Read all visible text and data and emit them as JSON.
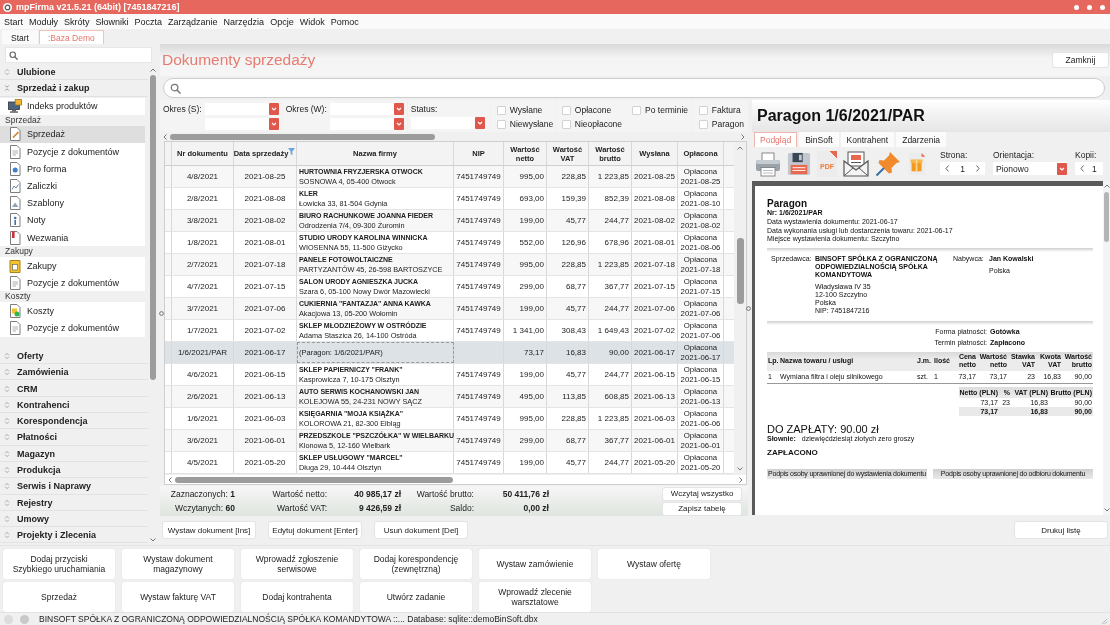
{
  "window": {
    "title": "mpFirma v21.5.21 (64bit) [7451847216]"
  },
  "menu": [
    "Start",
    "Moduły",
    "Skróty",
    "Słowniki",
    "Poczta",
    "Zarządzanie",
    "Narzędzia",
    "Opcje",
    "Widok",
    "Pomoc"
  ],
  "tabs": [
    {
      "label": "Start",
      "selected": false
    },
    {
      "label": ":Baza Demo",
      "selected": true
    }
  ],
  "sidebar": {
    "sections": [
      {
        "label": "Ulubione",
        "expanded": false
      },
      {
        "label": "Sprzedaż i zakup",
        "expanded": true,
        "items": [
          {
            "kind": "index",
            "label": "Indeks produktów",
            "selected": false
          },
          {
            "kind": "group",
            "label": "Sprzedaż"
          },
          {
            "kind": "sale",
            "label": "Sprzedaż",
            "selected": true
          },
          {
            "kind": "positions",
            "label": "Pozycje z dokumentów",
            "selected": false
          },
          {
            "kind": "proforma",
            "label": "Pro forma",
            "selected": false
          },
          {
            "kind": "advance",
            "label": "Zaliczki",
            "selected": false
          },
          {
            "kind": "template",
            "label": "Szablony",
            "selected": false
          },
          {
            "kind": "note",
            "label": "Noty",
            "selected": false
          },
          {
            "kind": "reminder",
            "label": "Wezwania",
            "selected": false
          },
          {
            "kind": "group",
            "label": "Zakupy"
          },
          {
            "kind": "purchase",
            "label": "Zakupy",
            "selected": false
          },
          {
            "kind": "positions",
            "label": "Pozycje z dokumentów",
            "selected": false
          },
          {
            "kind": "group",
            "label": "Koszty"
          },
          {
            "kind": "cost",
            "label": "Koszty",
            "selected": false
          },
          {
            "kind": "positions",
            "label": "Pozycje z dokumentów",
            "selected": false
          }
        ]
      },
      {
        "label": "Oferty",
        "expanded": false
      },
      {
        "label": "Zamówienia",
        "expanded": false
      },
      {
        "label": "CRM",
        "expanded": false
      },
      {
        "label": "Kontrahenci",
        "expanded": false
      },
      {
        "label": "Korespondencja",
        "expanded": false
      },
      {
        "label": "Płatności",
        "expanded": false
      },
      {
        "label": "Magazyn",
        "expanded": false
      },
      {
        "label": "Produkcja",
        "expanded": false
      },
      {
        "label": "Serwis i Naprawy",
        "expanded": false
      },
      {
        "label": "Rejestry",
        "expanded": false
      },
      {
        "label": "Umowy",
        "expanded": false
      },
      {
        "label": "Projekty i Zlecenia",
        "expanded": false
      }
    ]
  },
  "content": {
    "title": "Dokumenty sprzedaży",
    "close_button": "Zamknij"
  },
  "filters": {
    "periods": [
      {
        "label": "Okres (S):"
      },
      {
        "label": "Okres (W):"
      }
    ],
    "status": {
      "label": "Status:"
    },
    "checkbox_groups": [
      [
        [
          {
            "label": "Wysłane",
            "checked": false
          },
          {
            "label": "Niewysłane",
            "checked": false
          }
        ]
      ],
      [
        [
          {
            "label": "Opłacone",
            "checked": false
          },
          {
            "label": "Nieopłacone",
            "checked": false
          }
        ],
        [
          {
            "label": "Po terminie",
            "checked": false
          }
        ]
      ],
      [
        [
          {
            "label": "Faktura",
            "checked": false
          },
          {
            "label": "Paragon",
            "checked": false
          }
        ]
      ]
    ]
  },
  "table": {
    "columns": [
      {
        "label": "Nr dokumentu",
        "filtered": false
      },
      {
        "label": "Data sprzedaży",
        "filtered": true
      },
      {
        "label": "Nazwa firmy",
        "filtered": false
      },
      {
        "label": "NIP",
        "filtered": false
      },
      {
        "label": "Wartość netto",
        "filtered": false
      },
      {
        "label": "Wartość VAT",
        "filtered": false
      },
      {
        "label": "Wartość brutto",
        "filtered": false
      },
      {
        "label": "Wysłana",
        "filtered": false
      },
      {
        "label": "Opłacona",
        "filtered": false
      }
    ],
    "rows": [
      {
        "number": "4/8/2021",
        "date": "2021-08-25",
        "company": "HURTOWNIA FRYZJERSKA OTWOCK",
        "address": "SOSNOWA 4, 05-400 Otwock",
        "nip": "7451749749",
        "net": "995,00",
        "vat": "228,85",
        "gross": "1 223,85",
        "sent": "2021-08-25",
        "paid": "Opłacona",
        "paid_date": "2021-08-25",
        "selected": false
      },
      {
        "number": "2/8/2021",
        "date": "2021-08-08",
        "company": "KLER",
        "address": "Łowicka 33, 81-504 Gdynia",
        "nip": "7451749749",
        "net": "693,00",
        "vat": "159,39",
        "gross": "852,39",
        "sent": "2021-08-08",
        "paid": "Opłacona",
        "paid_date": "2021-08-10",
        "selected": false
      },
      {
        "number": "3/8/2021",
        "date": "2021-08-02",
        "company": "BIURO RACHUNKOWE JOANNA FIEDER",
        "address": "Odrodzenia 7/4, 09-300 Żuromin",
        "nip": "7451749749",
        "net": "199,00",
        "vat": "45,77",
        "gross": "244,77",
        "sent": "2021-08-02",
        "paid": "Opłacona",
        "paid_date": "2021-08-02",
        "selected": false
      },
      {
        "number": "1/8/2021",
        "date": "2021-08-01",
        "company": "STUDIO URODY KAROLINA WINNICKA",
        "address": "WIOSENNA 55, 11-500 Giżycko",
        "nip": "7451749749",
        "net": "552,00",
        "vat": "126,96",
        "gross": "678,96",
        "sent": "2021-08-01",
        "paid": "Opłacona",
        "paid_date": "2021-08-06",
        "selected": false
      },
      {
        "number": "2/7/2021",
        "date": "2021-07-18",
        "company": "PANELE FOTOWOLTAICZNE",
        "address": "PARTYZANTÓW 45, 26-598 BARTOSZYCE",
        "nip": "7451749749",
        "net": "995,00",
        "vat": "228,85",
        "gross": "1 223,85",
        "sent": "2021-07-18",
        "paid": "Opłacona",
        "paid_date": "2021-07-18",
        "selected": false
      },
      {
        "number": "4/7/2021",
        "date": "2021-07-15",
        "company": "SALON URODY AGNIESZKA JUCKA",
        "address": "Szara 6, 05-100 Nowy Dwór Mazowiecki",
        "nip": "7451749749",
        "net": "299,00",
        "vat": "68,77",
        "gross": "367,77",
        "sent": "2021-07-15",
        "paid": "Opłacona",
        "paid_date": "2021-07-15",
        "selected": false
      },
      {
        "number": "3/7/2021",
        "date": "2021-07-06",
        "company": "CUKIERNIA \"FANTAZJA\" ANNA KAWKA",
        "address": "Akacjowa 13, 05-200 Wołomin",
        "nip": "7451749749",
        "net": "199,00",
        "vat": "45,77",
        "gross": "244,77",
        "sent": "2021-07-06",
        "paid": "Opłacona",
        "paid_date": "2021-07-06",
        "selected": false
      },
      {
        "number": "1/7/2021",
        "date": "2021-07-02",
        "company": "SKLEP MŁODZIEŻOWY W OSTRÓDZIE",
        "address": "Adama Staszica 26, 14-100 Ostróda",
        "nip": "7451749749",
        "net": "1 341,00",
        "vat": "308,43",
        "gross": "1 649,43",
        "sent": "2021-07-02",
        "paid": "Opłacona",
        "paid_date": "2021-07-06",
        "selected": false
      },
      {
        "number": "1/6/2021/PAR",
        "date": "2021-06-17",
        "company": "(Paragon: 1/6/2021/PAR)",
        "net": "73,17",
        "vat": "16,83",
        "gross": "90,00",
        "sent": "2021-06-17",
        "paid": "Opłacona",
        "paid_date": "2021-06-17",
        "selected": true
      },
      {
        "number": "4/6/2021",
        "date": "2021-06-15",
        "company": "SKLEP PAPIERNICZY \"FRANK\"",
        "address": "Kasprowicza 7, 10-175 Olsztyn",
        "nip": "7451749749",
        "net": "199,00",
        "vat": "45,77",
        "gross": "244,77",
        "sent": "2021-06-15",
        "paid": "Opłacona",
        "paid_date": "2021-06-15",
        "selected": false
      },
      {
        "number": "2/6/2021",
        "date": "2021-06-13",
        "company": "AUTO SERWIS KOCHANOWSKI JAN",
        "address": "KOLEJOWA 55, 24-231 NOWY SĄCZ",
        "nip": "7451749749",
        "net": "495,00",
        "vat": "113,85",
        "gross": "608,85",
        "sent": "2021-06-13",
        "paid": "Opłacona",
        "paid_date": "2021-06-13",
        "selected": false
      },
      {
        "number": "1/6/2021",
        "date": "2021-06-03",
        "company": "KSIĘGARNIA \"MOJA KSIĄŻKA\"",
        "address": "KOLOROWA 21, 82-300 Elbląg",
        "nip": "7451749749",
        "net": "995,00",
        "vat": "228,85",
        "gross": "1 223,85",
        "sent": "2021-06-03",
        "paid": "Opłacona",
        "paid_date": "2021-06-06",
        "selected": false
      },
      {
        "number": "3/6/2021",
        "date": "2021-06-01",
        "company": "PRZEDSZKOLE \"PSZCZÓŁKA\" W WIELBARKU",
        "address": "Klonowa 5, 12-160 Wielbark",
        "nip": "7451749749",
        "net": "299,00",
        "vat": "68,77",
        "gross": "367,77",
        "sent": "2021-06-01",
        "paid": "Opłacona",
        "paid_date": "2021-06-01",
        "selected": false
      },
      {
        "number": "4/5/2021",
        "date": "2021-05-20",
        "company": "SKLEP USŁUGOWY \"MARCEL\"",
        "address": "Długa 29, 10-444 Olsztyn",
        "nip": "7451749749",
        "net": "199,00",
        "vat": "45,77",
        "gross": "244,77",
        "sent": "2021-05-20",
        "paid": "Opłacona",
        "paid_date": "2021-05-20",
        "selected": false
      }
    ]
  },
  "summary": {
    "rows": [
      {
        "count": "Zaznaczonych: **1**",
        "totals": [
          {
            "label": "Wartość netto:",
            "value": "40 985,17 zł"
          },
          {
            "label": "Wartość brutto:",
            "value": "50 411,76 zł"
          }
        ]
      },
      {
        "count": "Wczytanych: **60**",
        "totals": [
          {
            "label": "Wartość VAT:",
            "value": "9 426,59 zł"
          },
          {
            "label": "Saldo:",
            "value": "0,00 zł"
          }
        ]
      }
    ],
    "buttons": [
      "Wczytaj wszystko",
      "Zapisz tabelę"
    ]
  },
  "actions": [
    "Wystaw dokument [Ins]",
    "Edytuj dokument [Enter]",
    "Usuń dokument [Del]"
  ],
  "print_button": "Drukuj listę",
  "preview": {
    "title": "Paragon 1/6/2021/PAR",
    "tabs": [
      {
        "label": "Podgląd",
        "selected": true
      },
      {
        "label": "BinSoft",
        "selected": false
      },
      {
        "label": "Kontrahent",
        "selected": false
      },
      {
        "label": "Zdarzenia",
        "selected": false
      }
    ],
    "tools": [
      {
        "kind": "print"
      },
      {
        "kind": "save"
      },
      {
        "kind": "pdf",
        "label": "PDF"
      },
      {
        "kind": "email"
      },
      {
        "kind": "pin"
      },
      {
        "kind": "package"
      }
    ],
    "page": {
      "label": "Strona:",
      "value": "1"
    },
    "orientation": {
      "label": "Orientacja:",
      "value": "Pionowo"
    },
    "copies": {
      "label": "Kopii:",
      "value": "1"
    },
    "document": {
      "title": "Paragon",
      "number": "Nr: 1/6/2021/PAR",
      "details": [
        "Data wystawienia dokumentu: 2021-06-17",
        "Data wykonania usługi lub dostarczenia towaru: 2021-06-17",
        "Miejsce wystawienia dokumentu: Szczytno"
      ],
      "seller": {
        "label": "Sprzedawca:",
        "name": "BINSOFT SPÓŁKA Z OGRANICZONĄ ODPOWIEDZIALNOŚCIĄ SPÓŁKA KOMANDYTOWA",
        "address": [
          "Władysława IV 35",
          "12-100 Szczytno",
          "Polska",
          "NIP: 7451847216"
        ]
      },
      "buyer": {
        "label": "Nabywca:",
        "name": "Jan Kowalski",
        "address": [
          "Polska"
        ]
      },
      "payment": [
        {
          "label": "Forma płatności:",
          "value": "Gotówka"
        },
        {
          "label": "Termin płatności:",
          "value": "Zapłacono"
        }
      ],
      "items": {
        "columns": [
          "Lp.",
          "Nazwa towaru / usługi",
          "J.m.",
          "Ilość",
          "Cena netto",
          "Wartość netto",
          "Stawka VAT",
          "Kwota VAT",
          "Wartość brutto"
        ],
        "rows": [
          [
            "1",
            "Wymiana filtra i oleju silnikowego",
            "szt.",
            "1",
            "73,17",
            "73,17",
            "23",
            "16,83",
            "90,00"
          ]
        ]
      },
      "vat_summary": {
        "columns": [
          "Netto (PLN)",
          "%",
          "VAT (PLN)",
          "Brutto (PLN)"
        ],
        "rows": [
          {
            "net": "73,17",
            "rate": "23",
            "vat": "16,83",
            "gross": "90,00"
          }
        ],
        "total": {
          "net": "73,17",
          "vat": "16,83",
          "gross": "90,00"
        }
      },
      "amount_due": "DO ZAPŁATY: 90.00 zł",
      "in_words": {
        "label": "Słownie:",
        "value": "dziewięćdziesiąt złotych zero groszy"
      },
      "paid_stamp": "ZAPŁACONO",
      "signatures": [
        "Podpis osoby uprawnionej do wystawienia dokumentu",
        "Podpis osoby uprawnionej do odbioru dokumentu"
      ]
    }
  },
  "quick_actions": [
    [
      "Dodaj przyciski Szybkiego uruchamiania",
      "Wystaw dokument magazynowy",
      "Wprowadź zgłoszenie serwisowe",
      "Dodaj korespondencję (zewnętrzną)",
      "Wystaw zamówienie",
      "Wystaw ofertę"
    ],
    [
      "Sprzedaż",
      "Wystaw fakturę VAT",
      "Dodaj kontrahenta",
      "Utwórz zadanie",
      "Wprowadź zlecenie warsztatowe"
    ]
  ],
  "status_bar": {
    "text": "BINSOFT SPÓŁKA Z OGRANICZONĄ ODPOWIEDZIALNOŚCIĄ SPÓŁKA KOMANDYTOWA ::... Database: sqlite::demoBinSoft.dbx"
  }
}
